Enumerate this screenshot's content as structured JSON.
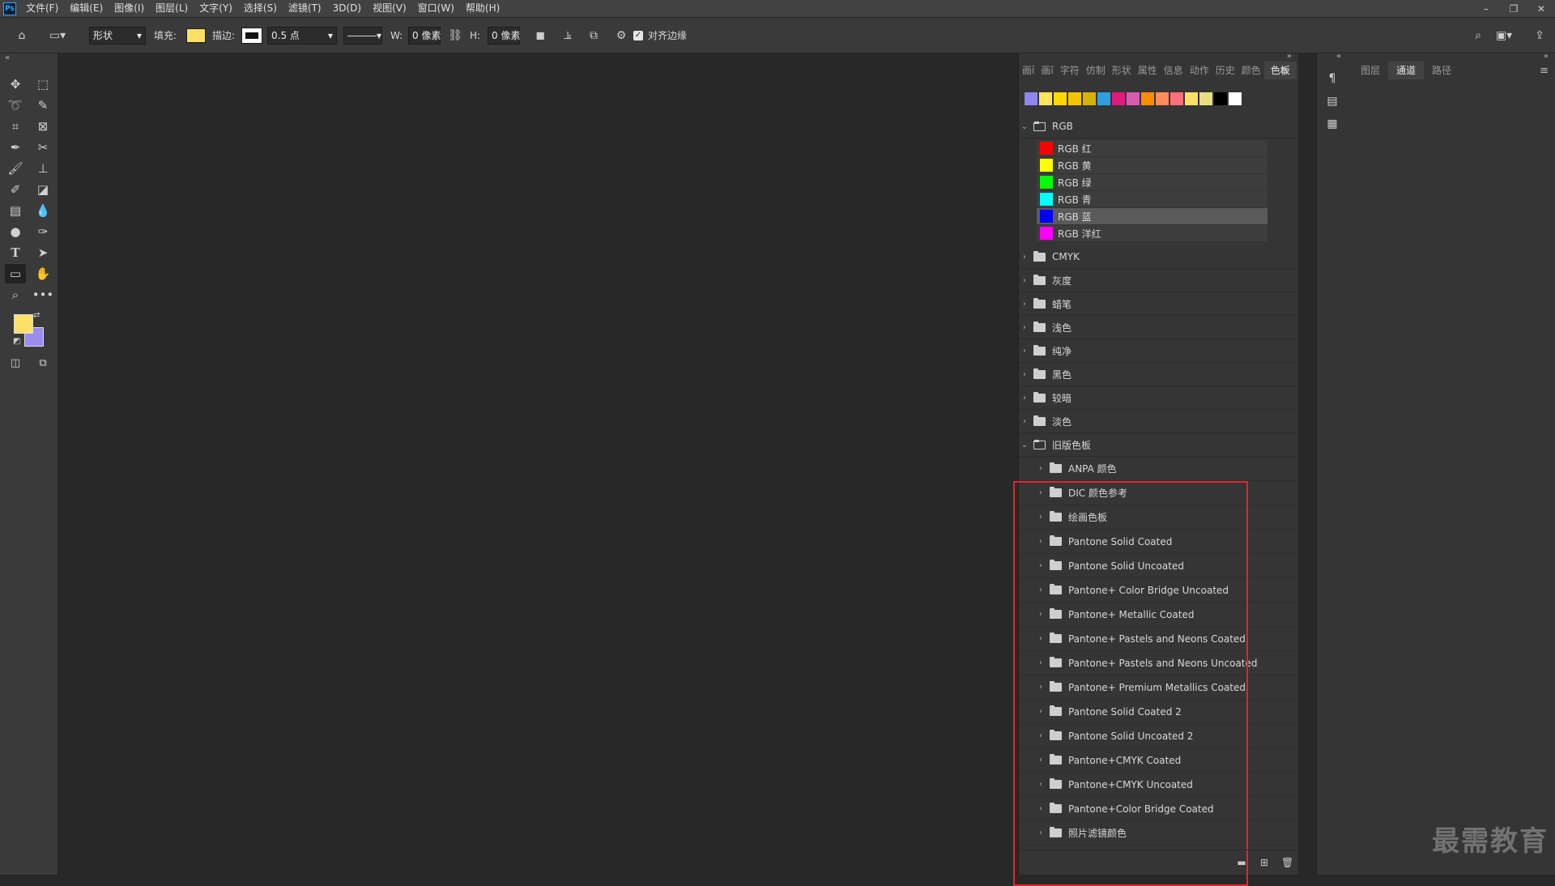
{
  "app": {
    "logo": "Ps"
  },
  "menu": [
    "文件(F)",
    "编辑(E)",
    "图像(I)",
    "图层(L)",
    "文字(Y)",
    "选择(S)",
    "滤镜(T)",
    "3D(D)",
    "视图(V)",
    "窗口(W)",
    "帮助(H)"
  ],
  "window_controls": {
    "minimize": "–",
    "restore": "❐",
    "close": "✕"
  },
  "options": {
    "mode_value": "形状",
    "fill_label": "填充:",
    "fill_color": "#ffe066",
    "stroke_label": "描边:",
    "stroke_width": "0.5 点",
    "w_label": "W:",
    "w_value": "0 像素",
    "h_label": "H:",
    "h_value": "0 像素",
    "align_edges_label": "对齐边缘",
    "align_edges_checked": true
  },
  "colors": {
    "foreground": "#ffe066",
    "background": "#9b8cf0"
  },
  "swatches_panel": {
    "tabs": [
      "画ī",
      "画ĭ",
      "字符",
      "仿制",
      "形状",
      "属性",
      "信息",
      "动作",
      "历史",
      "颜色",
      "色板"
    ],
    "active_tab": "色板",
    "recent": [
      "#8f86ef",
      "#ffe45c",
      "#ffd700",
      "#f5c400",
      "#d8b400",
      "#2b9fe0",
      "#e0197d",
      "#d65cb0",
      "#ff8c00",
      "#ff8c5a",
      "#ff6f7d",
      "#ffe066",
      "#e8e080",
      "#000000",
      "#ffffff"
    ],
    "rgb_group": {
      "name": "RGB",
      "items": [
        {
          "name": "RGB 红",
          "color": "#ff0000"
        },
        {
          "name": "RGB 黄",
          "color": "#ffff00"
        },
        {
          "name": "RGB 绿",
          "color": "#00ff00"
        },
        {
          "name": "RGB 青",
          "color": "#00ffff"
        },
        {
          "name": "RGB 蓝",
          "color": "#0000ff"
        },
        {
          "name": "RGB 洋红",
          "color": "#ff00ff"
        }
      ]
    },
    "groups": [
      "CMYK",
      "灰度",
      "蜡笔",
      "浅色",
      "纯净",
      "黑色",
      "较暗",
      "淡色"
    ],
    "legacy_group": {
      "name": "旧版色板",
      "items": [
        "ANPA 颜色",
        "DIC 颜色参考",
        "绘画色板",
        "Pantone Solid Coated",
        "Pantone Solid Uncoated",
        "Pantone+ Color Bridge Uncoated",
        "Pantone+ Metallic Coated",
        "Pantone+ Pastels and Neons Coated",
        "Pantone+ Pastels and Neons Uncoated",
        "Pantone+ Premium Metallics Coated",
        "Pantone Solid Coated 2",
        "Pantone Solid Uncoated 2",
        "Pantone+CMYK Coated",
        "Pantone+CMYK Uncoated",
        "Pantone+Color Bridge Coated",
        "照片滤镜颜色"
      ]
    }
  },
  "right_panel": {
    "tabs": [
      "图层",
      "通道",
      "路径"
    ],
    "active_tab": "通道"
  },
  "watermark": "最需教育"
}
